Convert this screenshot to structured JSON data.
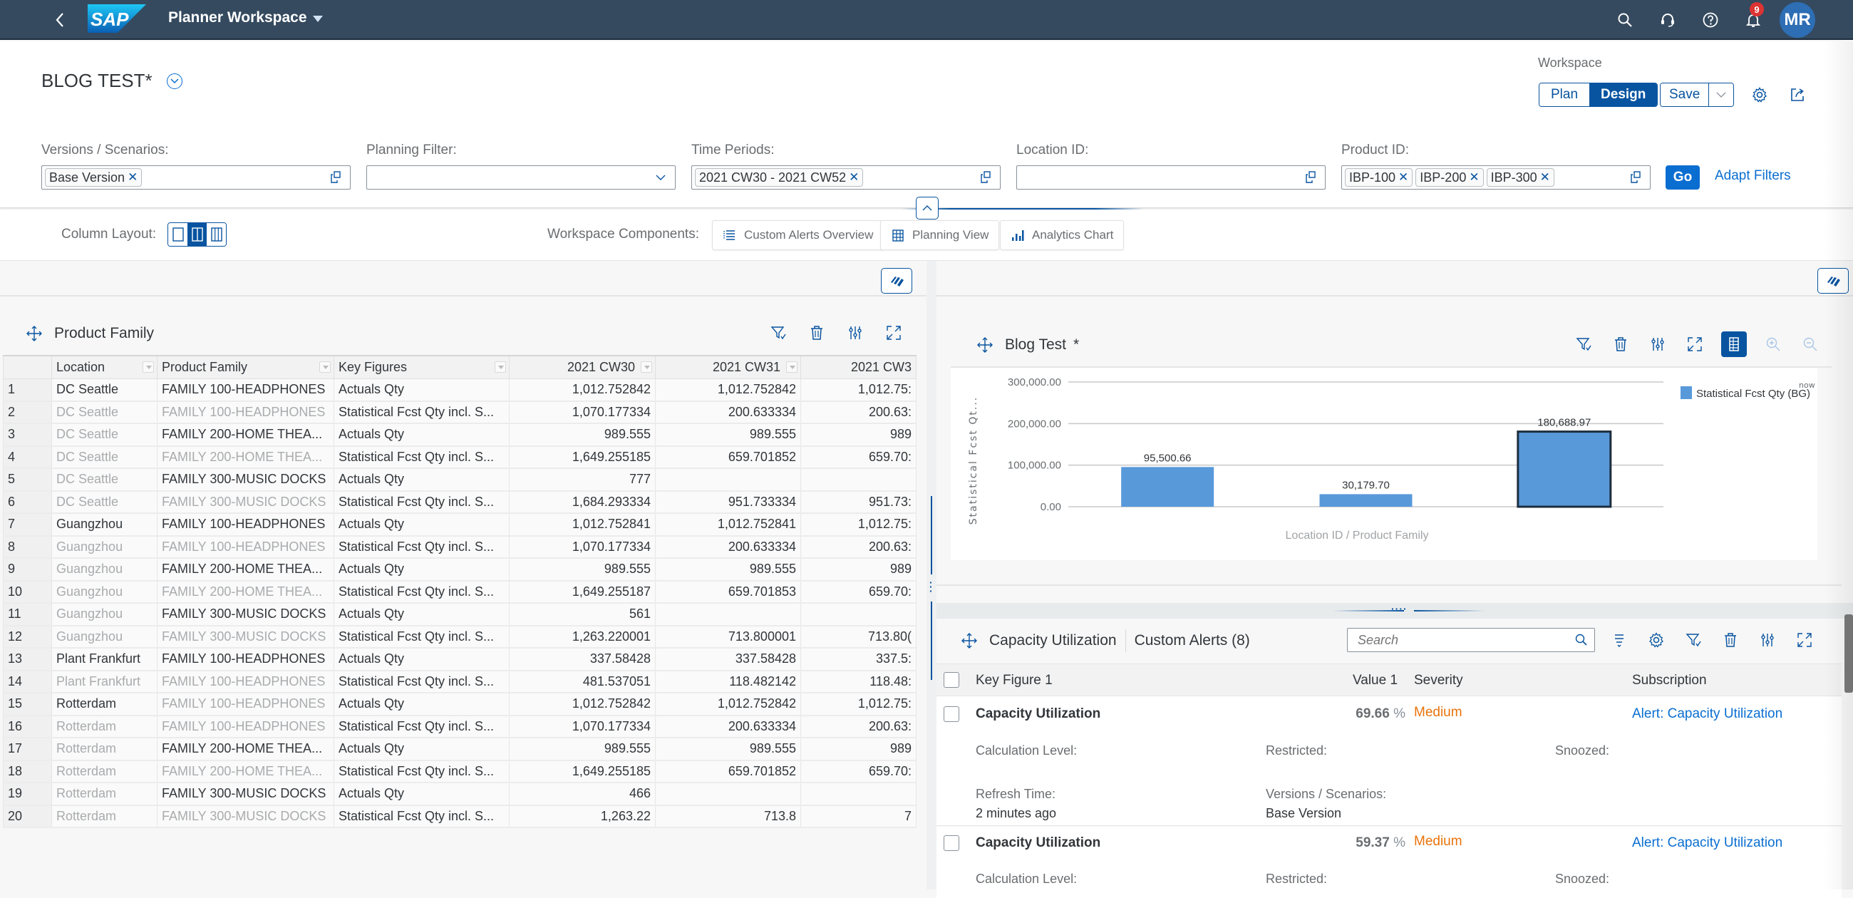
{
  "shell": {
    "app_title": "Planner Workspace",
    "notification_count": "9",
    "user_initials": "MR",
    "icons": [
      "back-icon",
      "search-icon",
      "headset-icon",
      "help-icon",
      "bell-icon"
    ]
  },
  "header": {
    "page_title": "BLOG TEST*",
    "workspace_label": "Workspace",
    "mode_plan": "Plan",
    "mode_design": "Design",
    "save_label": "Save"
  },
  "filters": {
    "versions": {
      "label": "Versions / Scenarios:",
      "tokens": [
        "Base Version"
      ]
    },
    "planning_filter": {
      "label": "Planning Filter:",
      "value": ""
    },
    "time_periods": {
      "label": "Time Periods:",
      "tokens": [
        "2021 CW30 - 2021 CW52"
      ]
    },
    "location_id": {
      "label": "Location ID:",
      "value": ""
    },
    "product_id": {
      "label": "Product ID:",
      "tokens": [
        "IBP-100",
        "IBP-200",
        "IBP-300"
      ]
    },
    "go_label": "Go",
    "adapt_label": "Adapt Filters"
  },
  "layoutbar": {
    "column_layout_label": "Column Layout:",
    "column_layout_selected": 2,
    "components_label": "Workspace Components:",
    "components": [
      "Custom Alerts Overview",
      "Planning View",
      "Analytics Chart"
    ]
  },
  "planning_view": {
    "title": "Product Family",
    "columns": [
      "",
      "Location",
      "Product Family",
      "Key Figures",
      "2021 CW30",
      "2021 CW31",
      "2021 CW3"
    ],
    "rows": [
      {
        "n": "1",
        "loc": "DC Seattle",
        "loc_dim": false,
        "pf": "FAMILY 100-HEADPHONES",
        "pf_dim": false,
        "kf": "Actuals Qty",
        "cw30": "1,012.752842",
        "cw31": "1,012.752842",
        "cw32": "1,012.75:"
      },
      {
        "n": "2",
        "loc": "DC Seattle",
        "loc_dim": true,
        "pf": "FAMILY 100-HEADPHONES",
        "pf_dim": true,
        "kf": "Statistical Fcst Qty incl. S...",
        "cw30": "1,070.177334",
        "cw31": "200.633334",
        "cw32": "200.63:"
      },
      {
        "n": "3",
        "loc": "DC Seattle",
        "loc_dim": true,
        "pf": "FAMILY 200-HOME THEA...",
        "pf_dim": false,
        "kf": "Actuals Qty",
        "cw30": "989.555",
        "cw31": "989.555",
        "cw32": "989"
      },
      {
        "n": "4",
        "loc": "DC Seattle",
        "loc_dim": true,
        "pf": "FAMILY 200-HOME THEA...",
        "pf_dim": true,
        "kf": "Statistical Fcst Qty incl. S...",
        "cw30": "1,649.255185",
        "cw31": "659.701852",
        "cw32": "659.70:"
      },
      {
        "n": "5",
        "loc": "DC Seattle",
        "loc_dim": true,
        "pf": "FAMILY 300-MUSIC DOCKS",
        "pf_dim": false,
        "kf": "Actuals Qty",
        "cw30": "777",
        "cw31": "",
        "cw32": ""
      },
      {
        "n": "6",
        "loc": "DC Seattle",
        "loc_dim": true,
        "pf": "FAMILY 300-MUSIC DOCKS",
        "pf_dim": true,
        "kf": "Statistical Fcst Qty incl. S...",
        "cw30": "1,684.293334",
        "cw31": "951.733334",
        "cw32": "951.73:"
      },
      {
        "n": "7",
        "loc": "Guangzhou",
        "loc_dim": false,
        "pf": "FAMILY 100-HEADPHONES",
        "pf_dim": false,
        "kf": "Actuals Qty",
        "cw30": "1,012.752841",
        "cw31": "1,012.752841",
        "cw32": "1,012.75:"
      },
      {
        "n": "8",
        "loc": "Guangzhou",
        "loc_dim": true,
        "pf": "FAMILY 100-HEADPHONES",
        "pf_dim": true,
        "kf": "Statistical Fcst Qty incl. S...",
        "cw30": "1,070.177334",
        "cw31": "200.633334",
        "cw32": "200.63:"
      },
      {
        "n": "9",
        "loc": "Guangzhou",
        "loc_dim": true,
        "pf": "FAMILY 200-HOME THEA...",
        "pf_dim": false,
        "kf": "Actuals Qty",
        "cw30": "989.555",
        "cw31": "989.555",
        "cw32": "989"
      },
      {
        "n": "10",
        "loc": "Guangzhou",
        "loc_dim": true,
        "pf": "FAMILY 200-HOME THEA...",
        "pf_dim": true,
        "kf": "Statistical Fcst Qty incl. S...",
        "cw30": "1,649.255187",
        "cw31": "659.701853",
        "cw32": "659.70:"
      },
      {
        "n": "11",
        "loc": "Guangzhou",
        "loc_dim": true,
        "pf": "FAMILY 300-MUSIC DOCKS",
        "pf_dim": false,
        "kf": "Actuals Qty",
        "cw30": "561",
        "cw31": "",
        "cw32": ""
      },
      {
        "n": "12",
        "loc": "Guangzhou",
        "loc_dim": true,
        "pf": "FAMILY 300-MUSIC DOCKS",
        "pf_dim": true,
        "kf": "Statistical Fcst Qty incl. S...",
        "cw30": "1,263.220001",
        "cw31": "713.800001",
        "cw32": "713.80("
      },
      {
        "n": "13",
        "loc": "Plant Frankfurt",
        "loc_dim": false,
        "pf": "FAMILY 100-HEADPHONES",
        "pf_dim": false,
        "kf": "Actuals Qty",
        "cw30": "337.58428",
        "cw31": "337.58428",
        "cw32": "337.5:"
      },
      {
        "n": "14",
        "loc": "Plant Frankfurt",
        "loc_dim": true,
        "pf": "FAMILY 100-HEADPHONES",
        "pf_dim": true,
        "kf": "Statistical Fcst Qty incl. S...",
        "cw30": "481.537051",
        "cw31": "118.482142",
        "cw32": "118.48:"
      },
      {
        "n": "15",
        "loc": "Rotterdam",
        "loc_dim": false,
        "pf": "FAMILY 100-HEADPHONES",
        "pf_dim": true,
        "kf": "Actuals Qty",
        "cw30": "1,012.752842",
        "cw31": "1,012.752842",
        "cw32": "1,012.75:"
      },
      {
        "n": "16",
        "loc": "Rotterdam",
        "loc_dim": true,
        "pf": "FAMILY 100-HEADPHONES",
        "pf_dim": true,
        "kf": "Statistical Fcst Qty incl. S...",
        "cw30": "1,070.177334",
        "cw31": "200.633334",
        "cw32": "200.63:"
      },
      {
        "n": "17",
        "loc": "Rotterdam",
        "loc_dim": true,
        "pf": "FAMILY 200-HOME THEA...",
        "pf_dim": false,
        "kf": "Actuals Qty",
        "cw30": "989.555",
        "cw31": "989.555",
        "cw32": "989"
      },
      {
        "n": "18",
        "loc": "Rotterdam",
        "loc_dim": true,
        "pf": "FAMILY 200-HOME THEA...",
        "pf_dim": true,
        "kf": "Statistical Fcst Qty incl. S...",
        "cw30": "1,649.255185",
        "cw31": "659.701852",
        "cw32": "659.70:"
      },
      {
        "n": "19",
        "loc": "Rotterdam",
        "loc_dim": true,
        "pf": "FAMILY 300-MUSIC DOCKS",
        "pf_dim": false,
        "kf": "Actuals Qty",
        "cw30": "466",
        "cw31": "",
        "cw32": ""
      },
      {
        "n": "20",
        "loc": "Rotterdam",
        "loc_dim": true,
        "pf": "FAMILY 300-MUSIC DOCKS",
        "pf_dim": true,
        "kf": "Statistical Fcst Qty incl. S...",
        "cw30": "1,263.22",
        "cw31": "713.8",
        "cw32": "7"
      }
    ]
  },
  "analytics_chart": {
    "title": "Blog Test",
    "modified_marker": "*"
  },
  "chart_data": {
    "type": "bar",
    "title": "",
    "xlabel": "Location ID / Product Family",
    "ylabel": "Statistical Fcst Qt...",
    "categories": [
      "",
      "",
      ""
    ],
    "series": [
      {
        "name": "Statistical Fcst Qty (BG)",
        "values": [
          95500.66,
          30179.7,
          180688.97
        ],
        "color": "#5899da"
      }
    ],
    "data_labels": [
      "95,500.66",
      "30,179.70",
      "180,688.97"
    ],
    "y_ticks": [
      "0.00",
      "100,000.00",
      "200,000.00",
      "300,000.00"
    ],
    "ylim": [
      0,
      300000
    ],
    "grid": true,
    "legend": "top-right",
    "legend_note": "now",
    "selected_index": 2
  },
  "alerts": {
    "title": "Capacity Utilization",
    "tab_label": "Custom Alerts (8)",
    "search_placeholder": "Search",
    "columns": {
      "kf": "Key Figure 1",
      "value": "Value 1",
      "severity": "Severity",
      "subscription": "Subscription"
    },
    "labels": {
      "calc_level": "Calculation Level:",
      "restricted": "Restricted:",
      "snoozed": "Snoozed:",
      "refresh": "Refresh Time:",
      "versions": "Versions / Scenarios:"
    },
    "items": [
      {
        "kf": "Capacity Utilization",
        "value": "69.66",
        "unit": "%",
        "severity": "Medium",
        "subscription": "Alert: Capacity Utilization",
        "refresh": "2 minutes ago",
        "version": "Base Version"
      },
      {
        "kf": "Capacity Utilization",
        "value": "59.37",
        "unit": "%",
        "severity": "Medium",
        "subscription": "Alert: Capacity Utilization"
      }
    ],
    "colors": {
      "severity_medium": "#e9730c",
      "link": "#0a6ed1"
    }
  }
}
